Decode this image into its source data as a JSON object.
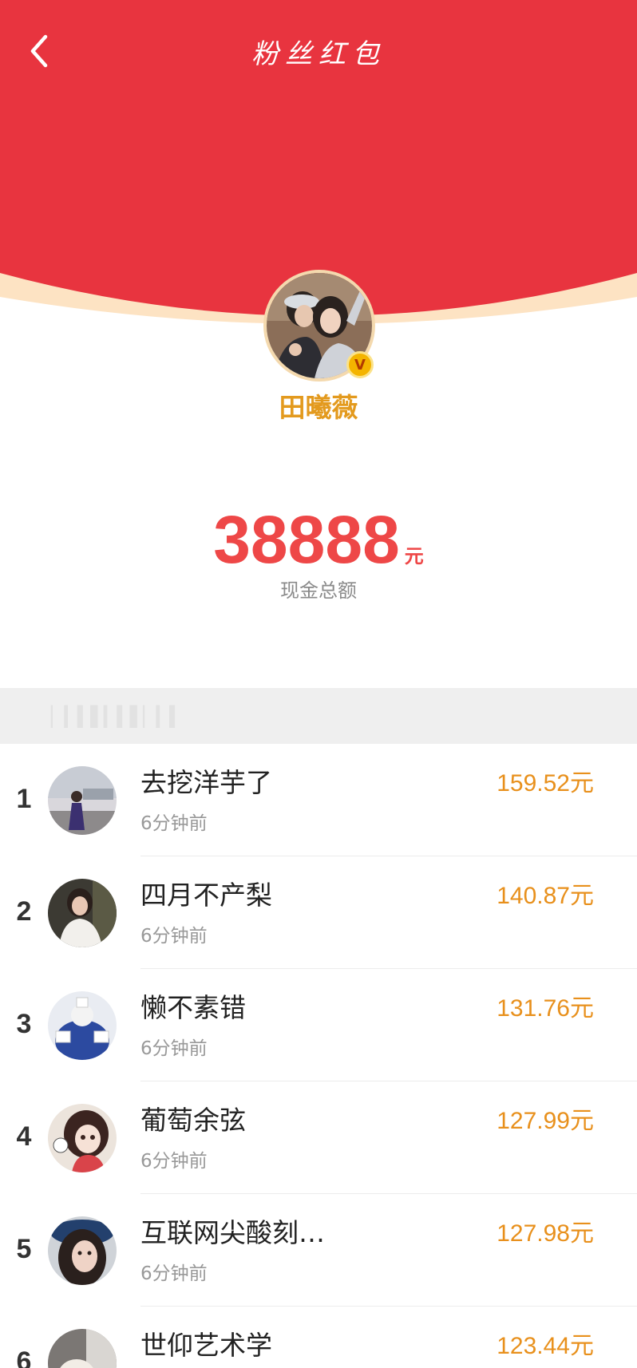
{
  "nav": {
    "title": "粉丝红包",
    "back_icon": "chevron-left-icon"
  },
  "theme": {
    "header_red": "#e8343f",
    "rim_cream": "#fde3c3",
    "host_name_color": "#e39a1e",
    "amount_color": "#ee4747",
    "list_amount_color": "#e8901c"
  },
  "host": {
    "name": "田曦薇",
    "verified_badge": "V"
  },
  "total": {
    "amount": "38888",
    "unit": "元",
    "label": "现金总额"
  },
  "list": [
    {
      "rank": "1",
      "name": "去挖洋芋了",
      "time": "6分钟前",
      "amount": "159.52元"
    },
    {
      "rank": "2",
      "name": "四月不产梨",
      "time": "6分钟前",
      "amount": "140.87元"
    },
    {
      "rank": "3",
      "name": "懒不素错",
      "time": "6分钟前",
      "amount": "131.76元"
    },
    {
      "rank": "4",
      "name": "葡萄余弦",
      "time": "6分钟前",
      "amount": "127.99元"
    },
    {
      "rank": "5",
      "name": "互联网尖酸刻…",
      "time": "6分钟前",
      "amount": "127.98元"
    },
    {
      "rank": "6",
      "name": "世仰艺术学",
      "time": "",
      "amount": "123.44元"
    }
  ]
}
